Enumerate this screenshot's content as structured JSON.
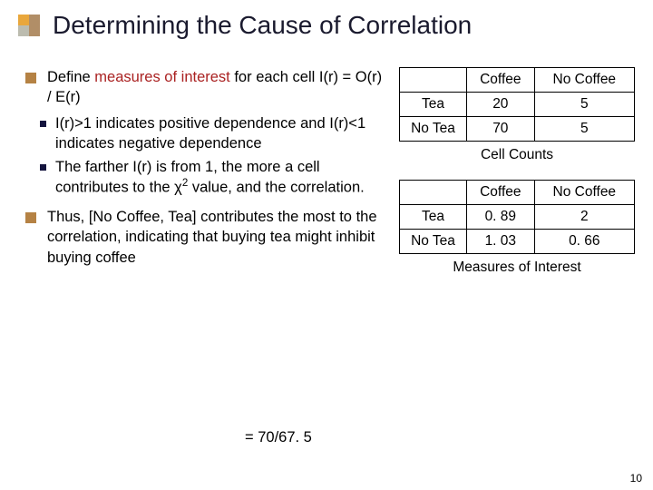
{
  "title": "Determining the Cause of Correlation",
  "bullets": {
    "b1_pre": "Define ",
    "b1_em": "measures of interest",
    "b1_post": " for each cell I(r) = O(r) / E(r)",
    "s1": "I(r)>1 indicates positive dependence and I(r)<1 indicates negative dependence",
    "s2": "The farther I(r) is from 1, the more a cell contributes to the χ",
    "s2_sup": "2",
    "s2_post": " value, and the correlation.",
    "b2": "Thus, [No Coffee, Tea] contributes the most to the correlation, indicating that buying tea might inhibit buying coffee"
  },
  "equation": "= 70/67. 5",
  "tables": {
    "counts": {
      "col1": "Coffee",
      "col2": "No Coffee",
      "r1": "Tea",
      "r1c1": "20",
      "r1c2": "5",
      "r2": "No Tea",
      "r2c1": "70",
      "r2c2": "5",
      "caption": "Cell Counts"
    },
    "interest": {
      "col1": "Coffee",
      "col2": "No Coffee",
      "r1": "Tea",
      "r1c1": "0. 89",
      "r1c2": "2",
      "r2": "No Tea",
      "r2c1": "1. 03",
      "r2c2": "0. 66",
      "caption": "Measures of Interest"
    }
  },
  "pagenum": "10",
  "chart_data": [
    {
      "type": "table",
      "title": "Cell Counts",
      "categories_cols": [
        "Coffee",
        "No Coffee"
      ],
      "categories_rows": [
        "Tea",
        "No Tea"
      ],
      "values": [
        [
          20,
          5
        ],
        [
          70,
          5
        ]
      ]
    },
    {
      "type": "table",
      "title": "Measures of Interest",
      "categories_cols": [
        "Coffee",
        "No Coffee"
      ],
      "categories_rows": [
        "Tea",
        "No Tea"
      ],
      "values": [
        [
          0.89,
          2
        ],
        [
          1.03,
          0.66
        ]
      ]
    }
  ]
}
